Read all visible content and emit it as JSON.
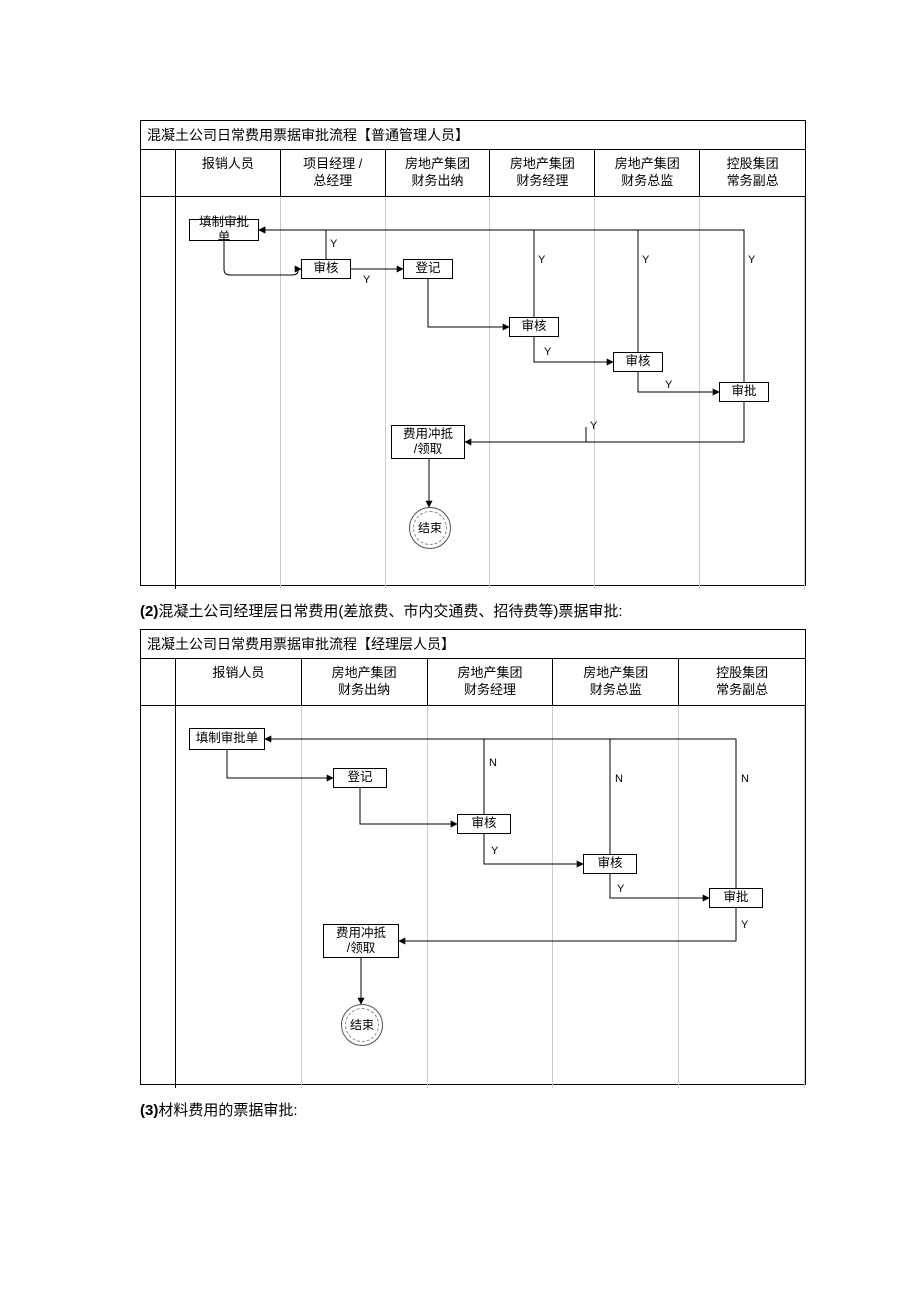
{
  "diagram1": {
    "title": "混凝土公司日常费用票据审批流程【普通管理人员】",
    "lanes": [
      "报销人员",
      "项目经理 /\n总经理",
      "房地产集团\n财务出纳",
      "房地产集团\n财务经理",
      "房地产集团\n财务总监",
      "控股集团\n常务副总"
    ],
    "nodes": {
      "fill": "填制审批单",
      "review1": "审核",
      "reg": "登记",
      "review2": "审核",
      "review3": "审核",
      "approve": "审批",
      "offset": "费用冲抵\n/领取",
      "end": "结束"
    },
    "edgeLabels": {
      "y": "Y"
    }
  },
  "caption2": "(2)混凝土公司经理层日常费用(差旅费、市内交通费、招待费等)票据审批:",
  "diagram2": {
    "title": "混凝土公司日常费用票据审批流程【经理层人员】",
    "lanes": [
      "报销人员",
      "房地产集团\n财务出纳",
      "房地产集团\n财务经理",
      "房地产集团\n财务总监",
      "控股集团\n常务副总"
    ],
    "nodes": {
      "fill": "填制审批单",
      "reg": "登记",
      "review1": "审核",
      "review2": "审核",
      "approve": "审批",
      "offset": "费用冲抵\n/领取",
      "end": "结束"
    },
    "edgeLabels": {
      "y": "Y",
      "n": "N"
    }
  },
  "caption3": "(3)材料费用的票据审批:"
}
